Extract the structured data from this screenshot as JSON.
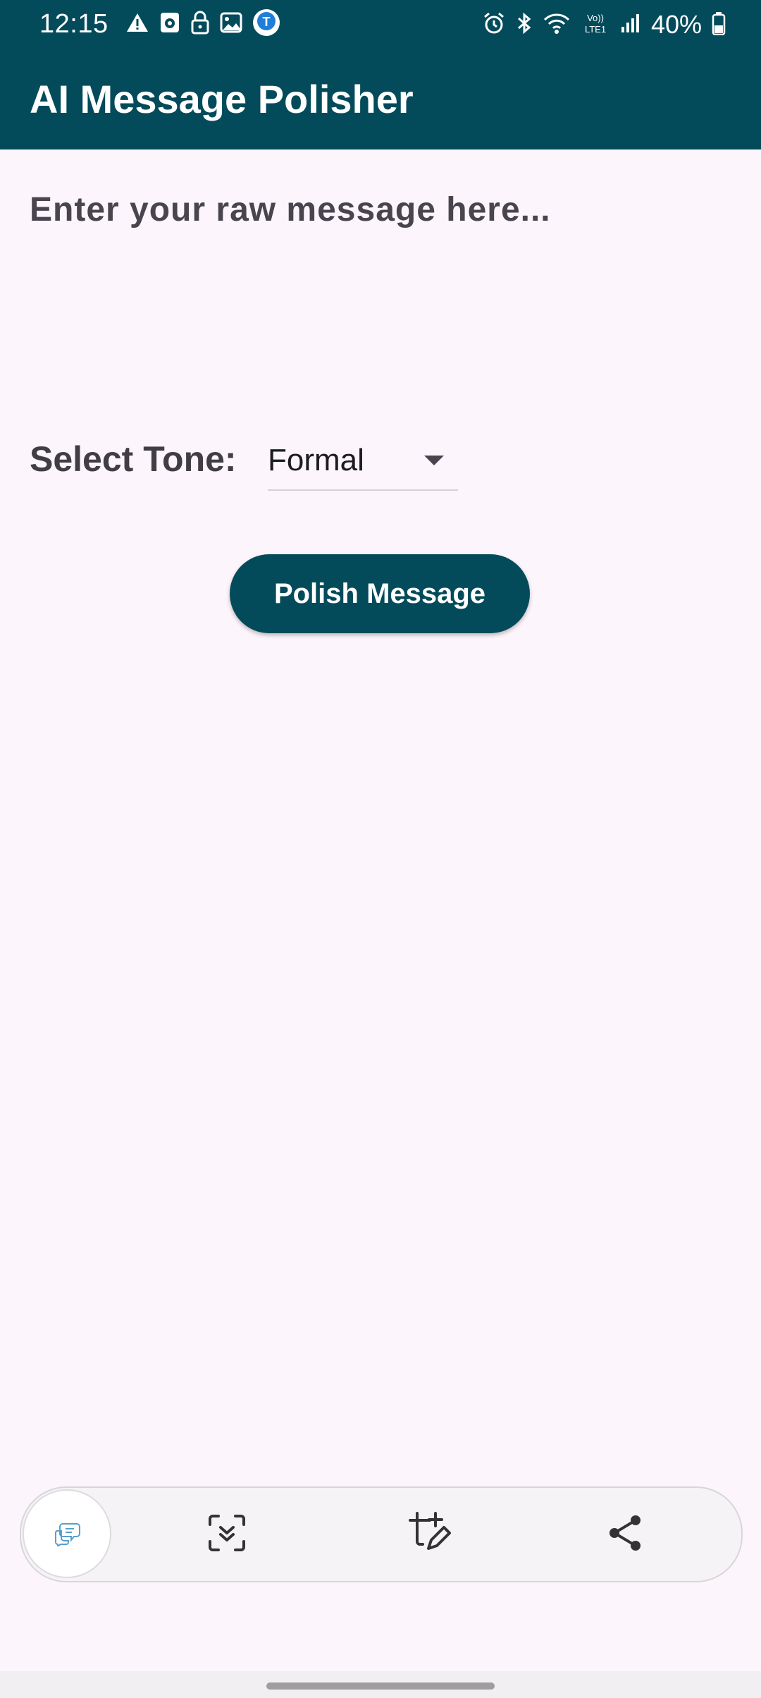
{
  "status_bar": {
    "time": "12:15",
    "battery": "40%",
    "left_icons": [
      "warning-icon",
      "camera-app-icon",
      "lock-icon",
      "gallery-icon",
      "notification-app-icon"
    ],
    "right_icons": [
      "alarm-icon",
      "bluetooth-icon",
      "wifi-icon",
      "volte-icon",
      "signal-icon",
      "battery-icon"
    ]
  },
  "app_bar": {
    "title": "AI Message Polisher",
    "background_color": "#034b5a"
  },
  "message_input": {
    "placeholder": "Enter your raw message here...",
    "value": ""
  },
  "tone": {
    "label": "Select Tone:",
    "selected": "Formal"
  },
  "polish_button": {
    "label": "Polish Message"
  },
  "floating_toolbar": {
    "items": [
      "chat-bubble-icon",
      "scroll-capture-icon",
      "crop-edit-icon",
      "share-icon"
    ]
  },
  "colors": {
    "accent": "#034b5a",
    "background": "#fcf5fb"
  }
}
